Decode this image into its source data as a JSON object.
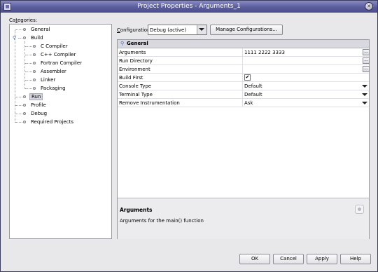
{
  "window": {
    "title": "Project Properties - Arguments_1"
  },
  "categories": {
    "label": "Categories:",
    "nodes": [
      {
        "label": "General",
        "selected": false
      },
      {
        "label": "Build",
        "selected": false,
        "expanded": true,
        "children": [
          "C Compiler",
          "C++ Compiler",
          "Fortran Compiler",
          "Assembler",
          "Linker",
          "Packaging"
        ]
      },
      {
        "label": "Run",
        "selected": true
      },
      {
        "label": "Profile",
        "selected": false
      },
      {
        "label": "Debug",
        "selected": false
      },
      {
        "label": "Required Projects",
        "selected": false
      }
    ]
  },
  "configuration": {
    "label": "Configuration:",
    "value": "Debug (active)",
    "manage_label": "Manage Configurations..."
  },
  "properties": {
    "section": "General",
    "rows": [
      {
        "name": "Arguments",
        "value": "1111 2222 3333",
        "control": "dots"
      },
      {
        "name": "Run Directory",
        "value": "",
        "control": "dots"
      },
      {
        "name": "Environment",
        "value": "",
        "control": "dots"
      },
      {
        "name": "Build First",
        "value": "checked",
        "control": "checkbox"
      },
      {
        "name": "Console Type",
        "value": "Default",
        "control": "dropdown"
      },
      {
        "name": "Terminal Type",
        "value": "Default",
        "control": "dropdown"
      },
      {
        "name": "Remove Instrumentation",
        "value": "Ask",
        "control": "dropdown"
      }
    ]
  },
  "description": {
    "title": "Arguments",
    "text": "Arguments for the main() function"
  },
  "buttons": {
    "ok": "OK",
    "cancel": "Cancel",
    "apply": "Apply",
    "help": "Help"
  },
  "colors": {
    "title_bar": "#5a5c9c",
    "dialog_bg": "#e8e8ea",
    "selection": "#d4d4dc"
  }
}
